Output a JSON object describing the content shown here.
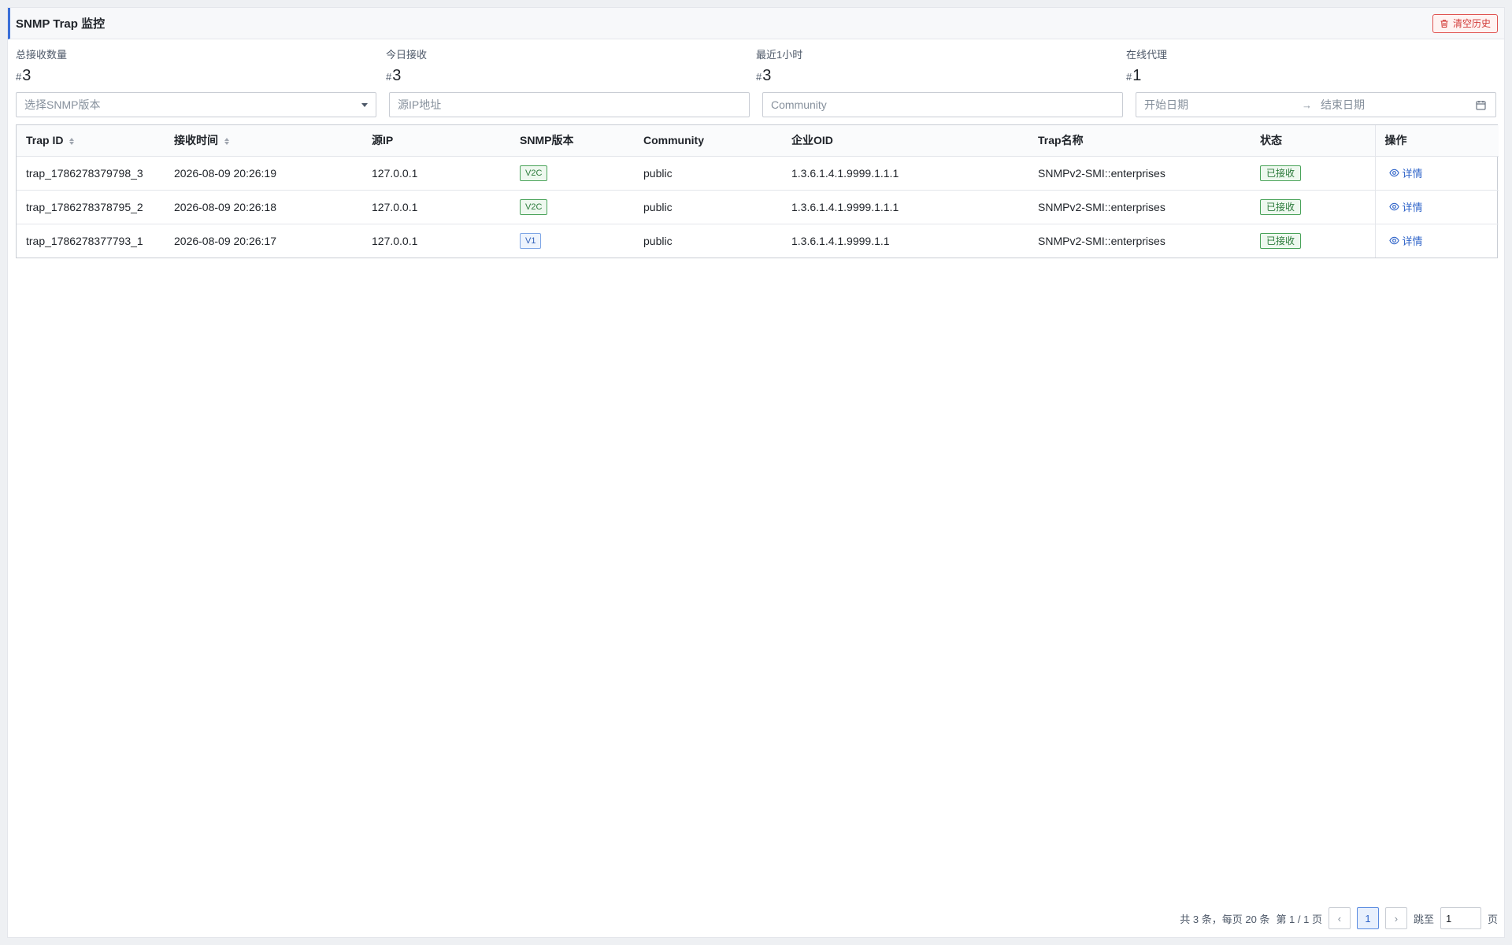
{
  "header": {
    "title": "SNMP Trap 监控",
    "clear_label": "清空历史"
  },
  "stats": [
    {
      "label": "总接收数量",
      "hash": "#",
      "value": "3"
    },
    {
      "label": "今日接收",
      "hash": "#",
      "value": "3"
    },
    {
      "label": "最近1小时",
      "hash": "#",
      "value": "3"
    },
    {
      "label": "在线代理",
      "hash": "#",
      "value": "1"
    }
  ],
  "filters": {
    "version_placeholder": "选择SNMP版本",
    "source_ip_placeholder": "源IP地址",
    "community_placeholder": "Community",
    "start_date_placeholder": "开始日期",
    "end_date_placeholder": "结束日期"
  },
  "table": {
    "columns": [
      "Trap ID",
      "接收时间",
      "源IP",
      "SNMP版本",
      "Community",
      "企业OID",
      "Trap名称",
      "状态",
      "操作"
    ],
    "rows": [
      {
        "id": "trap_1786278379798_3",
        "time": "2026-08-09 20:26:19",
        "ip": "127.0.0.1",
        "version": "V2C",
        "community": "public",
        "oid": "1.3.6.1.4.1.9999.1.1.1",
        "name": "SNMPv2-SMI::enterprises",
        "status": "已接收",
        "action": "详情"
      },
      {
        "id": "trap_1786278378795_2",
        "time": "2026-08-09 20:26:18",
        "ip": "127.0.0.1",
        "version": "V2C",
        "community": "public",
        "oid": "1.3.6.1.4.1.9999.1.1.1",
        "name": "SNMPv2-SMI::enterprises",
        "status": "已接收",
        "action": "详情"
      },
      {
        "id": "trap_1786278377793_1",
        "time": "2026-08-09 20:26:17",
        "ip": "127.0.0.1",
        "version": "V1",
        "community": "public",
        "oid": "1.3.6.1.4.1.9999.1.1",
        "name": "SNMPv2-SMI::enterprises",
        "status": "已接收",
        "action": "详情"
      }
    ]
  },
  "pagination": {
    "summary": "共 3 条，每页 20 条",
    "page_info": "第 1 / 1 页",
    "prev": "‹",
    "current": "1",
    "next": "›",
    "jump_label": "跳至",
    "jump_value": "1",
    "page_suffix": "页"
  }
}
